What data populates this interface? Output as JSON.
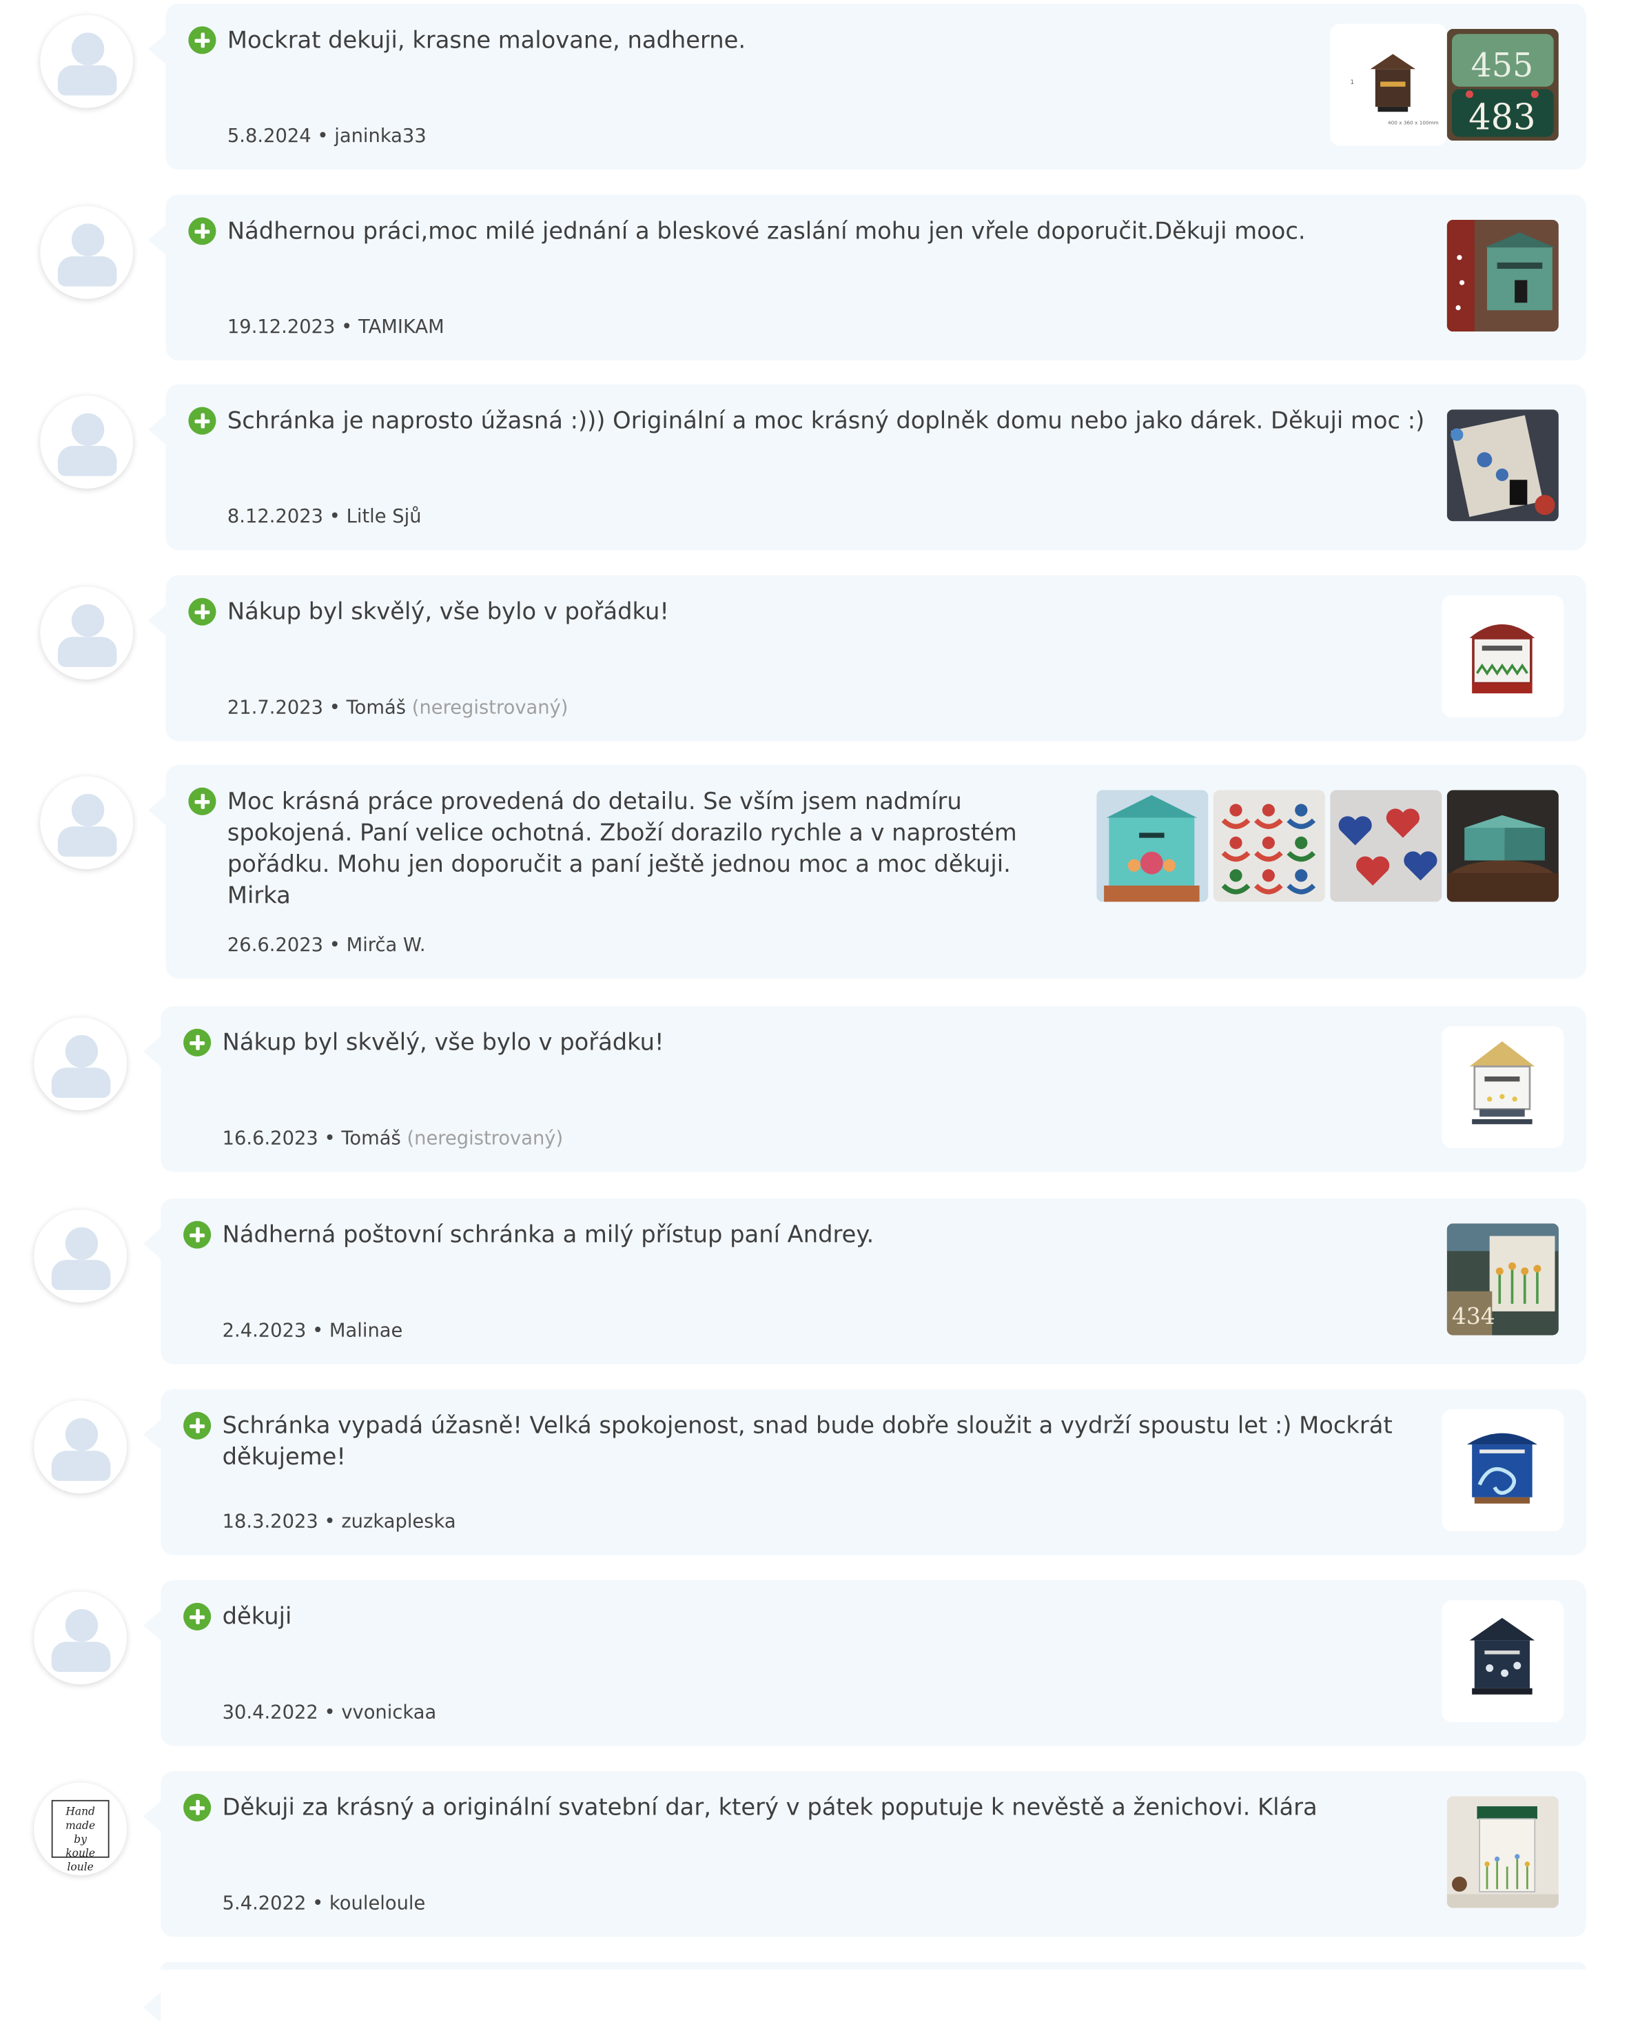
{
  "reviews": [
    {
      "text": "Mockrat dekuji, krasne malovane, nadherne.",
      "date": "5.8.2024",
      "author": "janinka33",
      "unregistered": "",
      "thumbs": [
        "mailbox-drawing-thumb",
        "house-number-sign-thumb"
      ]
    },
    {
      "text": "Nádhernou práci,moc milé jednání a bleskové zaslání mohu jen vřele doporučit.Děkuji mooc.",
      "date": "19.12.2023",
      "author": "TAMIKAM",
      "unregistered": "",
      "thumbs": [
        "painted-mailbox-photo-thumb"
      ]
    },
    {
      "text": "Schránka je naprosto úžasná :))) Originální a moc krásný doplněk domu nebo jako dárek. Děkuji moc :)",
      "date": "8.12.2023",
      "author": "Litle Sjů",
      "unregistered": "",
      "thumbs": [
        "blue-mailbox-photo-thumb"
      ]
    },
    {
      "text": "Nákup byl skvělý, vše bylo v pořádku!",
      "date": "21.7.2023",
      "author": "Tomáš",
      "unregistered": "(neregistrovaný)",
      "thumbs": [
        "white-red-mailbox-thumb"
      ]
    },
    {
      "text": "Moc krásná práce provedená do detailu. Se vším jsem nadmíru spokojená. Paní velice ochotná. Zboží dorazilo rychle a v naprostém pořádku. Mohu jen doporučit a paní ještě jednou moc a moc děkuji. Mirka",
      "date": "26.6.2023",
      "author": "Mirča W.",
      "unregistered": "",
      "thumbs": [
        "turquoise-mailbox-thumb",
        "rocking-horses-thumb",
        "hearts-thumb",
        "box-on-barrel-thumb"
      ]
    },
    {
      "text": "Nákup byl skvělý, vše bylo v pořádku!",
      "date": "16.6.2023",
      "author": "Tomáš",
      "unregistered": "(neregistrovaný)",
      "thumbs": [
        "white-house-mailbox-thumb"
      ]
    },
    {
      "text": "Nádherná poštovní schránka a milý přístup paní Andrey.",
      "date": "2.4.2023",
      "author": "Malinae",
      "unregistered": "",
      "thumbs": [
        "tulip-mailbox-photo-thumb"
      ]
    },
    {
      "text": "Schránka vypadá úžasně! Velká spokojenost, snad bude dobře sloužit a vydrží spoustu let :) Mockrát děkujeme!",
      "date": "18.3.2023",
      "author": "zuzkapleska",
      "unregistered": "",
      "thumbs": [
        "blue-wave-mailbox-thumb"
      ]
    },
    {
      "text": "děkuji",
      "date": "30.4.2022",
      "author": "vvonickaa",
      "unregistered": "",
      "thumbs": [
        "dark-house-mailbox-thumb"
      ]
    },
    {
      "text": "Děkuji za krásný a originální svatební dar, který v pátek poputuje k nevěstě a ženichovi. Klára",
      "date": "5.4.2022",
      "author": "kouleloule",
      "unregistered": "",
      "thumbs": [
        "meadow-mailbox-photo-thumb"
      ],
      "avatar_logo": "Hand made by koule loule"
    }
  ],
  "separator": "•"
}
